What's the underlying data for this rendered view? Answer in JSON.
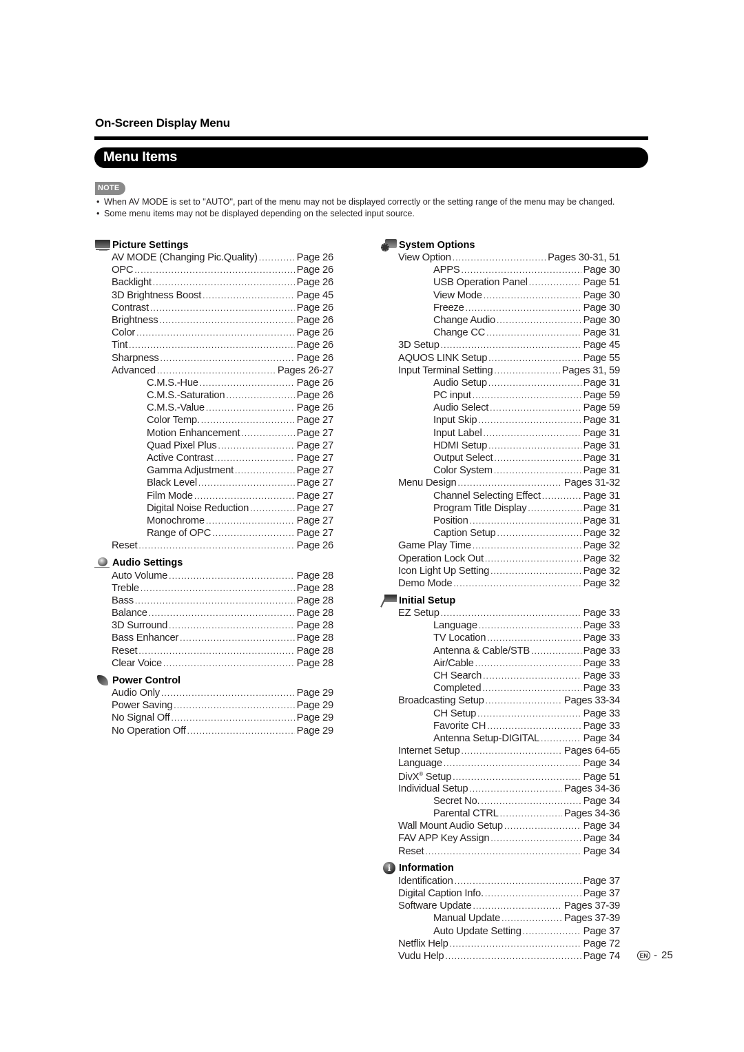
{
  "header": {
    "section": "On-Screen Display Menu",
    "title": "Menu Items"
  },
  "note": {
    "badge": "NOTE",
    "items": [
      "When AV MODE is set to \"AUTO\", part of the menu may not be displayed correctly or the setting range of the menu may be changed.",
      "Some menu items may not be displayed depending on the selected input source."
    ]
  },
  "left_column": [
    {
      "icon": "tv-icon",
      "title": "Picture Settings",
      "entries": [
        {
          "label": "AV MODE (Changing Pic.Quality)",
          "page": "Page 26",
          "level": 1
        },
        {
          "label": "OPC",
          "page": "Page 26",
          "level": 1
        },
        {
          "label": "Backlight",
          "page": "Page 26",
          "level": 1
        },
        {
          "label": "3D Brightness Boost",
          "page": "Page 45",
          "level": 1
        },
        {
          "label": "Contrast",
          "page": "Page 26",
          "level": 1
        },
        {
          "label": "Brightness",
          "page": "Page 26",
          "level": 1
        },
        {
          "label": "Color",
          "page": "Page 26",
          "level": 1
        },
        {
          "label": "Tint",
          "page": "Page 26",
          "level": 1
        },
        {
          "label": "Sharpness",
          "page": "Page 26",
          "level": 1
        },
        {
          "label": "Advanced",
          "page": "Pages 26-27",
          "level": 1
        },
        {
          "label": "C.M.S.-Hue",
          "page": "Page 26",
          "level": 2
        },
        {
          "label": "C.M.S.-Saturation",
          "page": "Page 26",
          "level": 2
        },
        {
          "label": "C.M.S.-Value",
          "page": "Page 26",
          "level": 2
        },
        {
          "label": "Color Temp.",
          "page": "Page 27",
          "level": 2
        },
        {
          "label": "Motion Enhancement",
          "page": "Page 27",
          "level": 2
        },
        {
          "label": "Quad Pixel Plus",
          "page": "Page 27",
          "level": 2
        },
        {
          "label": "Active Contrast",
          "page": "Page 27",
          "level": 2
        },
        {
          "label": "Gamma Adjustment",
          "page": "Page 27",
          "level": 2
        },
        {
          "label": "Black Level",
          "page": "Page 27",
          "level": 2
        },
        {
          "label": "Film Mode",
          "page": "Page 27",
          "level": 2
        },
        {
          "label": "Digital Noise Reduction",
          "page": "Page 27",
          "level": 2
        },
        {
          "label": "Monochrome",
          "page": "Page 27",
          "level": 2
        },
        {
          "label": "Range of OPC",
          "page": "Page 27",
          "level": 2
        },
        {
          "label": "Reset",
          "page": "Page 26",
          "level": 1
        }
      ]
    },
    {
      "icon": "audio-icon",
      "title": "Audio Settings",
      "entries": [
        {
          "label": "Auto Volume",
          "page": "Page 28",
          "level": 1
        },
        {
          "label": "Treble",
          "page": "Page 28",
          "level": 1
        },
        {
          "label": "Bass",
          "page": "Page 28",
          "level": 1
        },
        {
          "label": "Balance",
          "page": "Page 28",
          "level": 1
        },
        {
          "label": "3D Surround",
          "page": "Page 28",
          "level": 1
        },
        {
          "label": "Bass Enhancer",
          "page": "Page 28",
          "level": 1
        },
        {
          "label": "Reset",
          "page": "Page 28",
          "level": 1
        },
        {
          "label": "Clear Voice",
          "page": "Page 28",
          "level": 1
        }
      ]
    },
    {
      "icon": "power-icon",
      "title": "Power Control",
      "entries": [
        {
          "label": "Audio Only",
          "page": "Page 29",
          "level": 1
        },
        {
          "label": "Power Saving",
          "page": "Page 29",
          "level": 1
        },
        {
          "label": "No Signal Off",
          "page": "Page 29",
          "level": 1
        },
        {
          "label": "No Operation Off",
          "page": "Page 29",
          "level": 1
        }
      ]
    }
  ],
  "right_column": [
    {
      "icon": "system-options-icon",
      "title": "System Options",
      "entries": [
        {
          "label": "View Option",
          "page": "Pages 30-31, 51",
          "level": 1
        },
        {
          "label": "APPS",
          "page": "Page 30",
          "level": 2
        },
        {
          "label": "USB Operation Panel",
          "page": "Page 51",
          "level": 2
        },
        {
          "label": "View Mode",
          "page": "Page 30",
          "level": 2
        },
        {
          "label": "Freeze",
          "page": "Page 30",
          "level": 2
        },
        {
          "label": "Change Audio",
          "page": "Page 30",
          "level": 2
        },
        {
          "label": "Change CC",
          "page": "Page 31",
          "level": 2
        },
        {
          "label": "3D Setup",
          "page": "Page 45",
          "level": 1
        },
        {
          "label": "AQUOS LINK Setup",
          "page": "Page 55",
          "level": 1
        },
        {
          "label": "Input Terminal Setting",
          "page": "Pages 31, 59",
          "level": 1
        },
        {
          "label": "Audio Setup",
          "page": "Page 31",
          "level": 2
        },
        {
          "label": "PC input",
          "page": "Page 59",
          "level": 2
        },
        {
          "label": "Audio Select",
          "page": "Page 59",
          "level": 2
        },
        {
          "label": "Input Skip",
          "page": "Page 31",
          "level": 2
        },
        {
          "label": "Input Label",
          "page": "Page 31",
          "level": 2
        },
        {
          "label": "HDMI Setup",
          "page": "Page 31",
          "level": 2
        },
        {
          "label": "Output Select",
          "page": "Page 31",
          "level": 2
        },
        {
          "label": "Color System",
          "page": "Page 31",
          "level": 2
        },
        {
          "label": "Menu Design",
          "page": "Pages 31-32",
          "level": 1
        },
        {
          "label": "Channel Selecting Effect",
          "page": "Page 31",
          "level": 2
        },
        {
          "label": "Program Title Display",
          "page": "Page 31",
          "level": 2
        },
        {
          "label": "Position",
          "page": "Page 31",
          "level": 2
        },
        {
          "label": "Caption Setup",
          "page": "Page 32",
          "level": 2
        },
        {
          "label": "Game Play Time",
          "page": "Page 32",
          "level": 1
        },
        {
          "label": "Operation Lock Out",
          "page": "Page 32",
          "level": 1
        },
        {
          "label": "Icon Light Up Setting",
          "page": "Page 32",
          "level": 1
        },
        {
          "label": "Demo Mode",
          "page": "Page 32",
          "level": 1
        }
      ]
    },
    {
      "icon": "initial-setup-icon",
      "title": "Initial Setup",
      "entries": [
        {
          "label": "EZ Setup",
          "page": "Page 33",
          "level": 1
        },
        {
          "label": "Language",
          "page": "Page 33",
          "level": 2
        },
        {
          "label": "TV Location",
          "page": "Page 33",
          "level": 2
        },
        {
          "label": "Antenna & Cable/STB",
          "page": "Page 33",
          "level": 2
        },
        {
          "label": "Air/Cable",
          "page": "Page 33",
          "level": 2
        },
        {
          "label": "CH Search",
          "page": "Page 33",
          "level": 2
        },
        {
          "label": "Completed",
          "page": "Page 33",
          "level": 2
        },
        {
          "label": "Broadcasting Setup",
          "page": "Pages 33-34",
          "level": 1
        },
        {
          "label": "CH Setup",
          "page": "Page 33",
          "level": 2
        },
        {
          "label": "Favorite CH",
          "page": "Page 33",
          "level": 2
        },
        {
          "label": "Antenna Setup-DIGITAL",
          "page": "Page 34",
          "level": 2
        },
        {
          "label": "Internet Setup",
          "page": "Pages 64-65",
          "level": 1
        },
        {
          "label": "Language",
          "page": "Page 34",
          "level": 1
        },
        {
          "label": "DivX",
          "label_sup": "®",
          "label_suffix": " Setup",
          "page": "Page 51",
          "level": 1
        },
        {
          "label": "Individual Setup",
          "page": "Pages 34-36",
          "level": 1
        },
        {
          "label": "Secret No.",
          "page": "Page 34",
          "level": 2
        },
        {
          "label": "Parental CTRL",
          "page": "Pages 34-36",
          "level": 2
        },
        {
          "label": "Wall Mount Audio Setup",
          "page": "Page 34",
          "level": 1
        },
        {
          "label": "FAV APP Key Assign",
          "page": "Page 34",
          "level": 1
        },
        {
          "label": "Reset",
          "page": "Page 34",
          "level": 1
        }
      ]
    },
    {
      "icon": "information-icon",
      "title": "Information",
      "entries": [
        {
          "label": "Identification",
          "page": "Page 37",
          "level": 1
        },
        {
          "label": "Digital Caption Info.",
          "page": "Page 37",
          "level": 1
        },
        {
          "label": "Software Update",
          "page": "Pages 37-39",
          "level": 1
        },
        {
          "label": "Manual Update",
          "page": "Pages 37-39",
          "level": 2
        },
        {
          "label": "Auto Update Setting",
          "page": "Page 37",
          "level": 2
        },
        {
          "label": "Netflix Help",
          "page": "Page 72",
          "level": 1
        },
        {
          "label": "Vudu Help",
          "page": "Page 74",
          "level": 1
        }
      ]
    }
  ],
  "footer": {
    "lang_badge": "EN",
    "separator": "-",
    "page_number": "25"
  }
}
